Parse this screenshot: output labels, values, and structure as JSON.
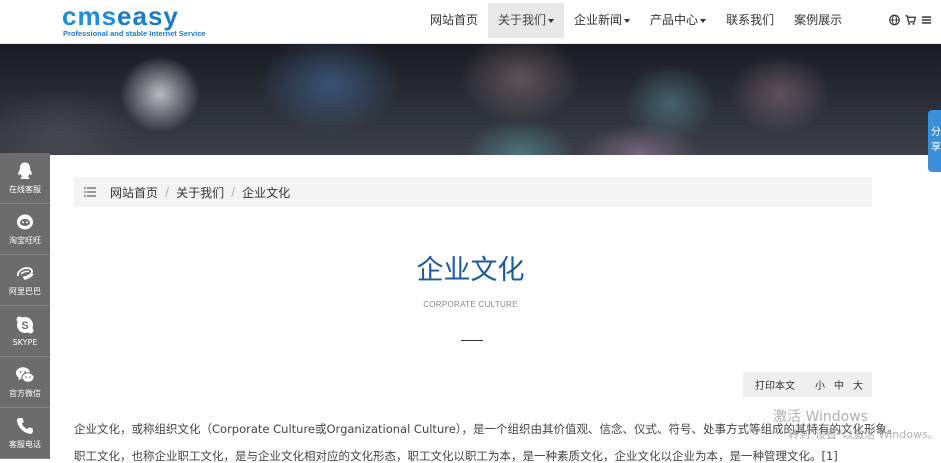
{
  "header": {
    "logo": {
      "main_cms": "cms",
      "main_easy": "easy",
      "tagline": "Professional and stable Internet Service"
    },
    "nav": [
      {
        "label": "网站首页",
        "dropdown": false
      },
      {
        "label": "关于我们",
        "dropdown": true,
        "active": true
      },
      {
        "label": "企业新闻",
        "dropdown": true
      },
      {
        "label": "产品中心",
        "dropdown": true
      },
      {
        "label": "联系我们",
        "dropdown": false
      },
      {
        "label": "案例展示",
        "dropdown": false
      }
    ],
    "icons": [
      "globe-icon",
      "cart-icon",
      "menu-icon"
    ]
  },
  "float_bar": [
    {
      "label": "在线客服",
      "icon": "qq-icon"
    },
    {
      "label": "淘宝旺旺",
      "icon": "wangwang-icon"
    },
    {
      "label": "阿里巴巴",
      "icon": "alibaba-icon"
    },
    {
      "label": "SKYPE",
      "icon": "skype-icon"
    },
    {
      "label": "官方微信",
      "icon": "wechat-icon"
    },
    {
      "label": "客服电话",
      "icon": "phone-icon"
    }
  ],
  "share_tab": {
    "label": "分享"
  },
  "breadcrumb": {
    "items": [
      "网站首页",
      "关于我们",
      "企业文化"
    ],
    "separator": "/"
  },
  "page": {
    "title": "企业文化",
    "subtitle": "CORPORATE CULTURE"
  },
  "tools": {
    "print": "打印本文",
    "font_small": "小",
    "font_medium": "中",
    "font_large": "大"
  },
  "content": {
    "paragraph_1": "企业文化，或称组织文化（Corporate Culture或Organizational Culture），是一个组织由其价值观、信念、仪式、符号、处事方式等组成的其特有的文化形象。",
    "paragraph_2": "职工文化，也称企业职工文化，是与企业文化相对应的文化形态，职工文化以职工为本，是一种素质文化，企业文化以企业为本，是一种管理文化。[1]"
  },
  "watermark": {
    "line1": "激活 Windows",
    "line2": "转到\"设置\"以激活 Windows。"
  },
  "colors": {
    "brand": "#1a7dc8",
    "title": "#1f5a9a",
    "float_bar": "#6c6c6c",
    "share_tab": "#3b8fd8"
  }
}
